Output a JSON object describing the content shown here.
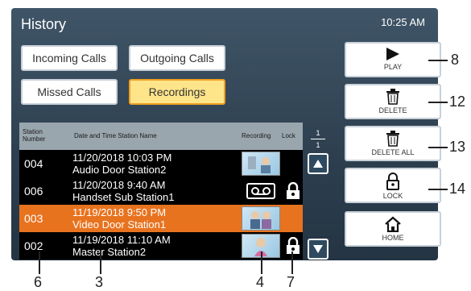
{
  "header": {
    "title": "History",
    "clock": "10:25 AM"
  },
  "filters": {
    "incoming": "Incoming Calls",
    "outgoing": "Outgoing Calls",
    "missed": "Missed Calls",
    "recordings": "Recordings"
  },
  "table": {
    "headers": {
      "station_number": "Station Number",
      "date_station": "Date and Time Station Name",
      "recording": "Recording",
      "lock": "Lock"
    },
    "page": {
      "current": "1",
      "total": "1"
    },
    "rows": [
      {
        "num": "004",
        "datetime": "11/20/2018 10:03 PM",
        "station": "Audio Door Station2",
        "recording": "thumbnail",
        "locked": false
      },
      {
        "num": "006",
        "datetime": "11/20/2018  9:40 AM",
        "station": "Handset Sub Station1",
        "recording": "tape",
        "locked": true
      },
      {
        "num": "003",
        "datetime": "11/19/2018  9:50 PM",
        "station": "Video Door Station1",
        "recording": "thumbnail",
        "locked": false
      },
      {
        "num": "002",
        "datetime": "11/19/2018 11:10 AM",
        "station": "Master Station2",
        "recording": "thumbnail",
        "locked": true
      }
    ]
  },
  "sidebar": {
    "play": "PLAY",
    "delete": "DELETE",
    "delete_all": "DELETE ALL",
    "lock": "LOCK",
    "home": "HOME"
  },
  "callouts": {
    "c8": "8",
    "c12": "12",
    "c13": "13",
    "c14": "14",
    "c6": "6",
    "c3": "3",
    "c4": "4",
    "c7": "7"
  },
  "colors": {
    "selected_row": "#e8731f",
    "active_filter": "#ffe58a"
  }
}
